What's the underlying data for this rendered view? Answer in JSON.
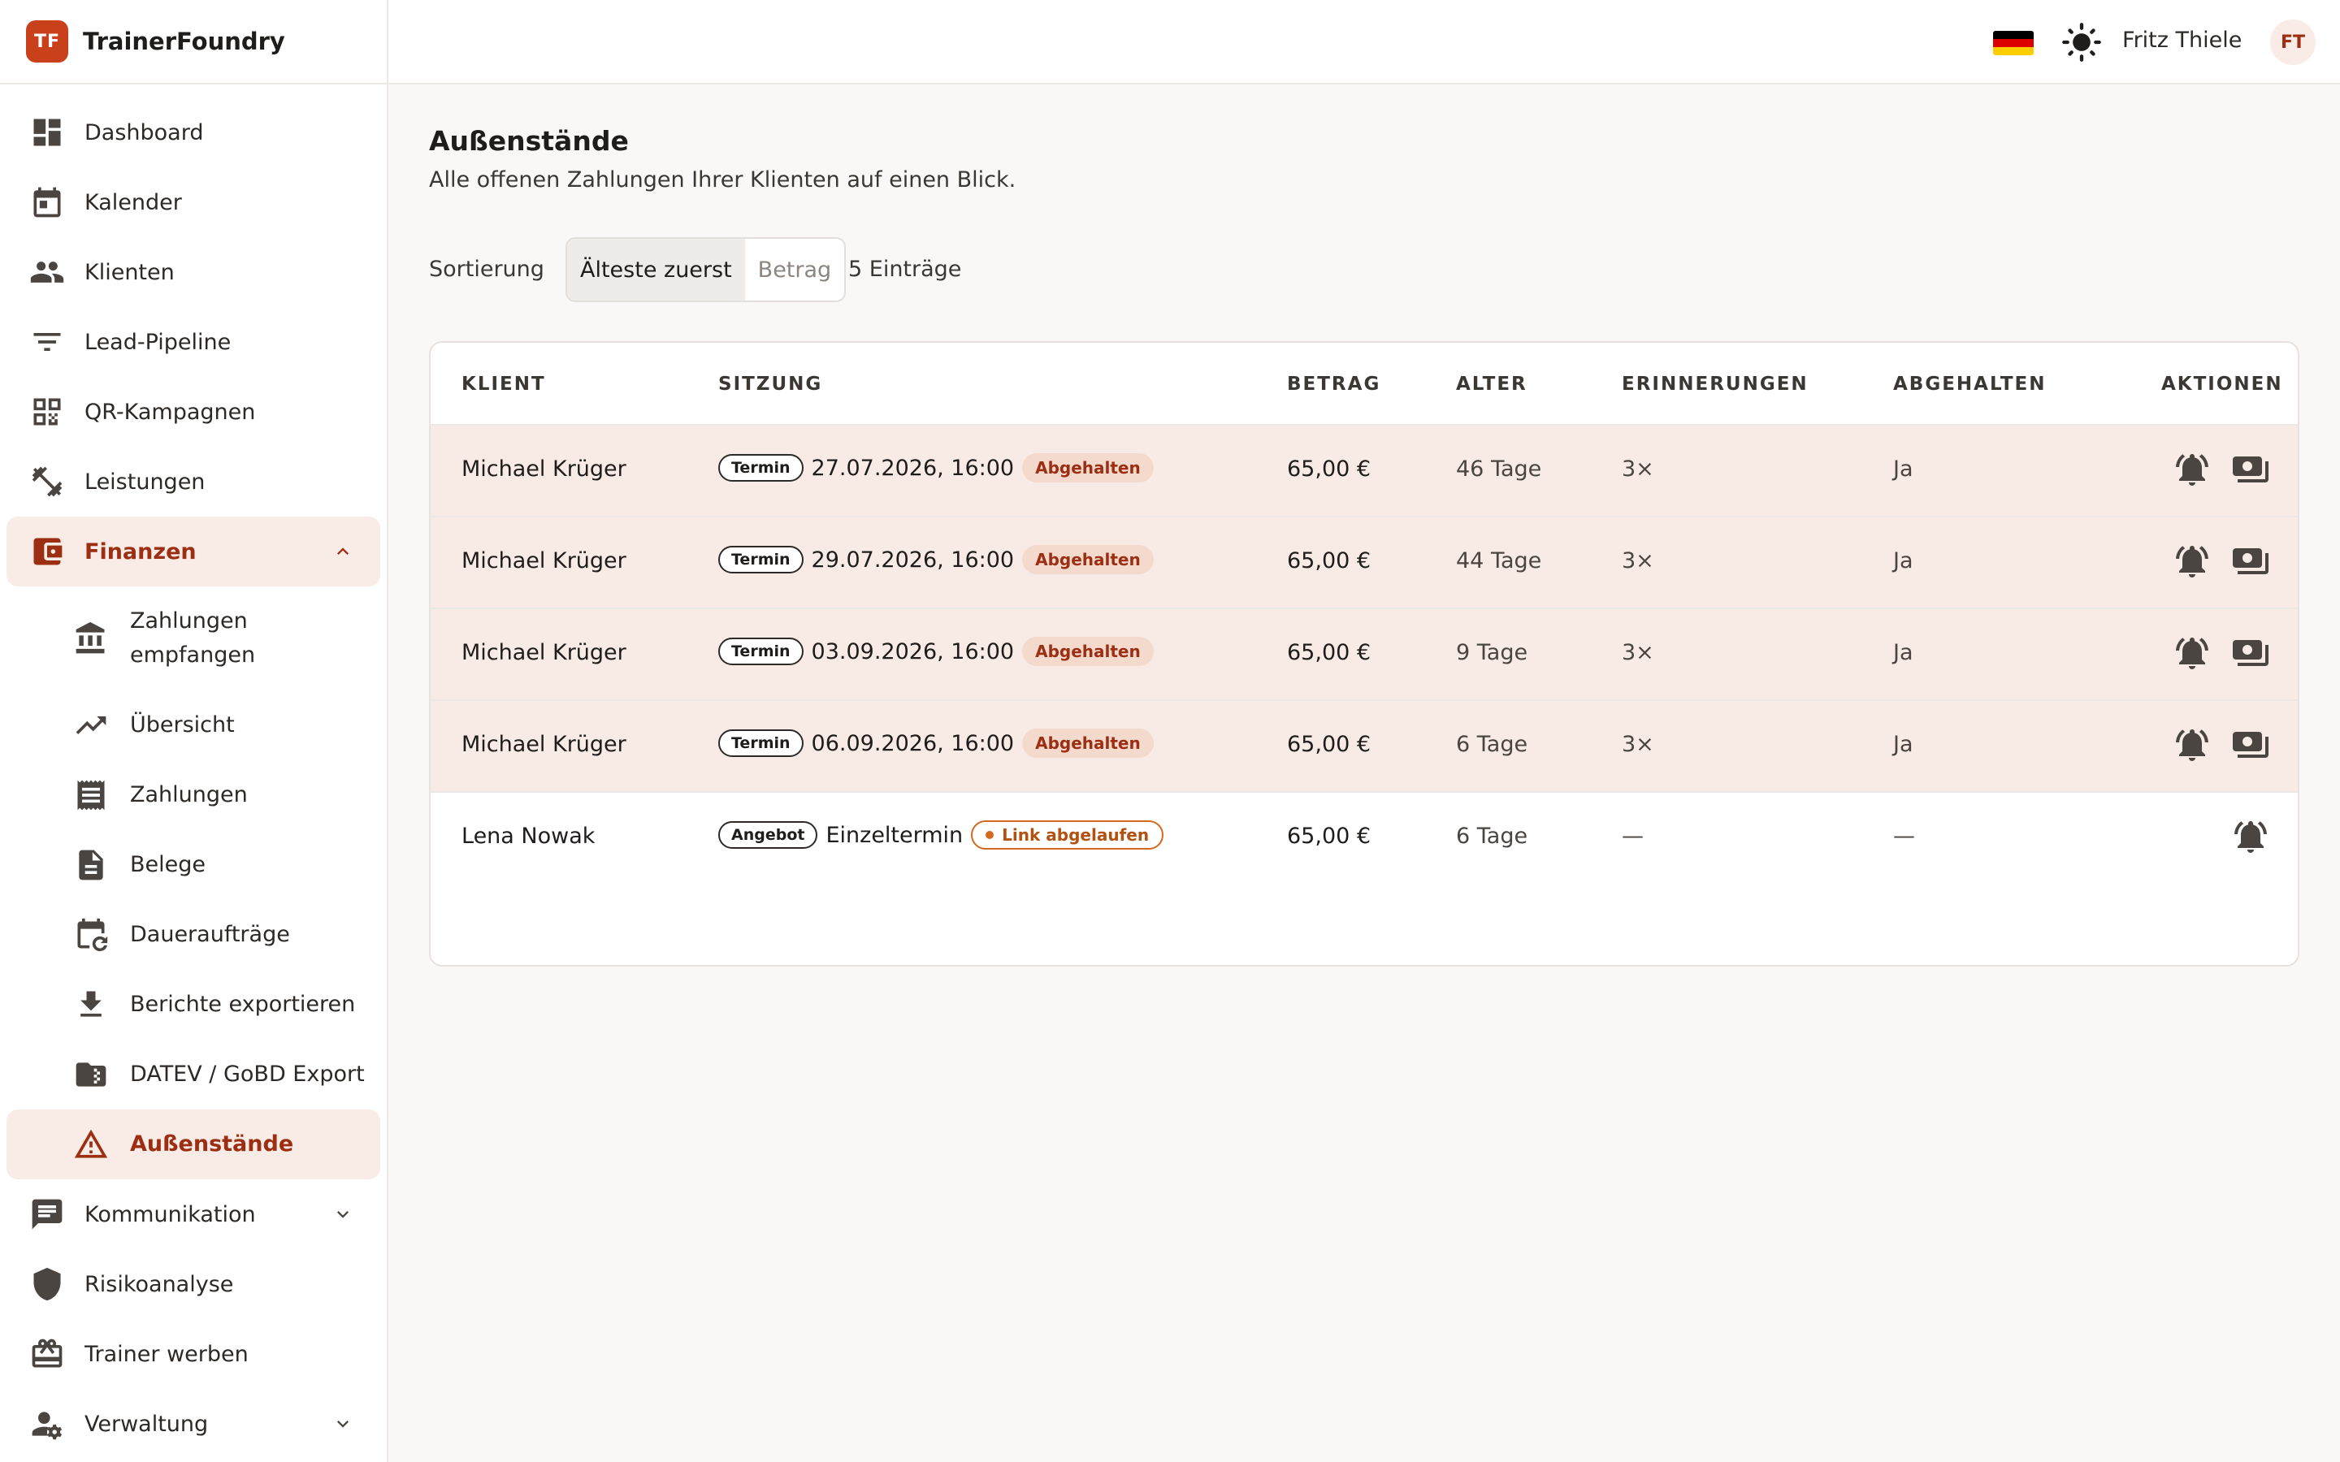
{
  "brand": {
    "logo": "TF",
    "name": "TrainerFoundry"
  },
  "header": {
    "user_name": "Fritz Thiele",
    "avatar_initials": "FT",
    "flag_colors": [
      "#000000",
      "#dd0000",
      "#ffce00"
    ]
  },
  "sidebar": {
    "items": [
      {
        "label": "Dashboard",
        "icon": "dashboard-icon"
      },
      {
        "label": "Kalender",
        "icon": "calendar-icon"
      },
      {
        "label": "Klienten",
        "icon": "people-icon"
      },
      {
        "label": "Lead-Pipeline",
        "icon": "filter-icon"
      },
      {
        "label": "QR-Kampagnen",
        "icon": "qr-code-icon"
      },
      {
        "label": "Leistungen",
        "icon": "dumbbell-icon"
      },
      {
        "label": "Finanzen",
        "icon": "wallet-icon"
      }
    ],
    "finance_sub": [
      {
        "label": "Zahlungen empfangen",
        "icon": "bank-icon"
      },
      {
        "label": "Übersicht",
        "icon": "trending-up-icon"
      },
      {
        "label": "Zahlungen",
        "icon": "receipt-icon"
      },
      {
        "label": "Belege",
        "icon": "document-icon"
      },
      {
        "label": "Daueraufträge",
        "icon": "recurring-calendar-icon"
      },
      {
        "label": "Berichte exportieren",
        "icon": "download-icon"
      },
      {
        "label": "DATEV / GoBD Export",
        "icon": "folder-zip-icon"
      },
      {
        "label": "Außenstände",
        "icon": "warning-icon"
      }
    ],
    "bottom_items": [
      {
        "label": "Kommunikation",
        "icon": "chat-icon"
      },
      {
        "label": "Risikoanalyse",
        "icon": "shield-icon"
      },
      {
        "label": "Trainer werben",
        "icon": "gift-card-icon"
      },
      {
        "label": "Verwaltung",
        "icon": "user-settings-icon"
      }
    ]
  },
  "main": {
    "title": "Außenstände",
    "subtitle": "Alle offenen Zahlungen Ihrer Klienten auf einen Blick.",
    "sort_label": "Sortierung",
    "sort_options": [
      "Älteste zuerst",
      "Betrag"
    ],
    "entry_count": "5 Einträge",
    "columns": [
      "KLIENT",
      "SITZUNG",
      "BETRAG",
      "ALTER",
      "ERINNERUNGEN",
      "ABGEHALTEN",
      "AKTIONEN"
    ],
    "rows": [
      {
        "client": "Michael Krüger",
        "type": "Termin",
        "session": "27.07.2026, 16:00",
        "status": "Abgehalten",
        "amount": "65,00 €",
        "age": "46 Tage",
        "reminders": "3×",
        "held": "Ja"
      },
      {
        "client": "Michael Krüger",
        "type": "Termin",
        "session": "29.07.2026, 16:00",
        "status": "Abgehalten",
        "amount": "65,00 €",
        "age": "44 Tage",
        "reminders": "3×",
        "held": "Ja"
      },
      {
        "client": "Michael Krüger",
        "type": "Termin",
        "session": "03.09.2026, 16:00",
        "status": "Abgehalten",
        "amount": "65,00 €",
        "age": "9 Tage",
        "reminders": "3×",
        "held": "Ja"
      },
      {
        "client": "Michael Krüger",
        "type": "Termin",
        "session": "06.09.2026, 16:00",
        "status": "Abgehalten",
        "amount": "65,00 €",
        "age": "6 Tage",
        "reminders": "3×",
        "held": "Ja"
      },
      {
        "client": "Lena Nowak",
        "type": "Angebot",
        "session": "Einzeltermin",
        "status": "Link abgelaufen",
        "amount": "65,00 €",
        "age": "6 Tage",
        "reminders": "—",
        "held": "—"
      }
    ]
  }
}
